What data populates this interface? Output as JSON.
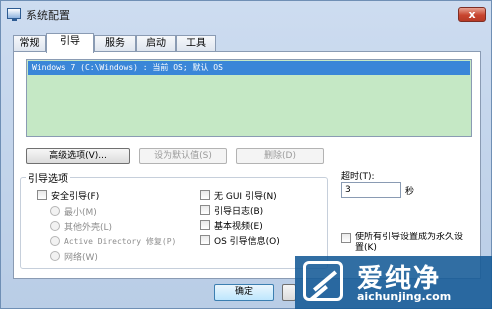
{
  "window": {
    "title": "系统配置"
  },
  "titlebar": {
    "close_glyph": "x"
  },
  "tabs": [
    {
      "label": "常规"
    },
    {
      "label": "引导"
    },
    {
      "label": "服务"
    },
    {
      "label": "启动"
    },
    {
      "label": "工具"
    }
  ],
  "boot": {
    "os_entries": [
      "Windows 7 (C:\\Windows) : 当前 OS; 默认 OS"
    ],
    "advanced_button": "高级选项(V)...",
    "set_default_button": "设为默认值(S)",
    "delete_button": "删除(D)",
    "options_title": "引导选项",
    "safe_boot": "安全引导(F)",
    "minimal": "最小(M)",
    "alternate_shell": "其他外壳(L)",
    "active_directory": "Active Directory 修复(P)",
    "network": "网络(W)",
    "no_gui": "无 GUI 引导(N)",
    "boot_log": "引导日志(B)",
    "base_video": "基本视频(E)",
    "os_boot_info": "OS 引导信息(O)",
    "timeout_label": "超时(T):",
    "timeout_value": "3",
    "timeout_unit": "秒",
    "make_permanent": "使所有引导设置成为永久设置(K)"
  },
  "footer": {
    "ok_button": "确定"
  },
  "watermark": {
    "brand": "爱纯净",
    "url": "aichunjing.com"
  }
}
